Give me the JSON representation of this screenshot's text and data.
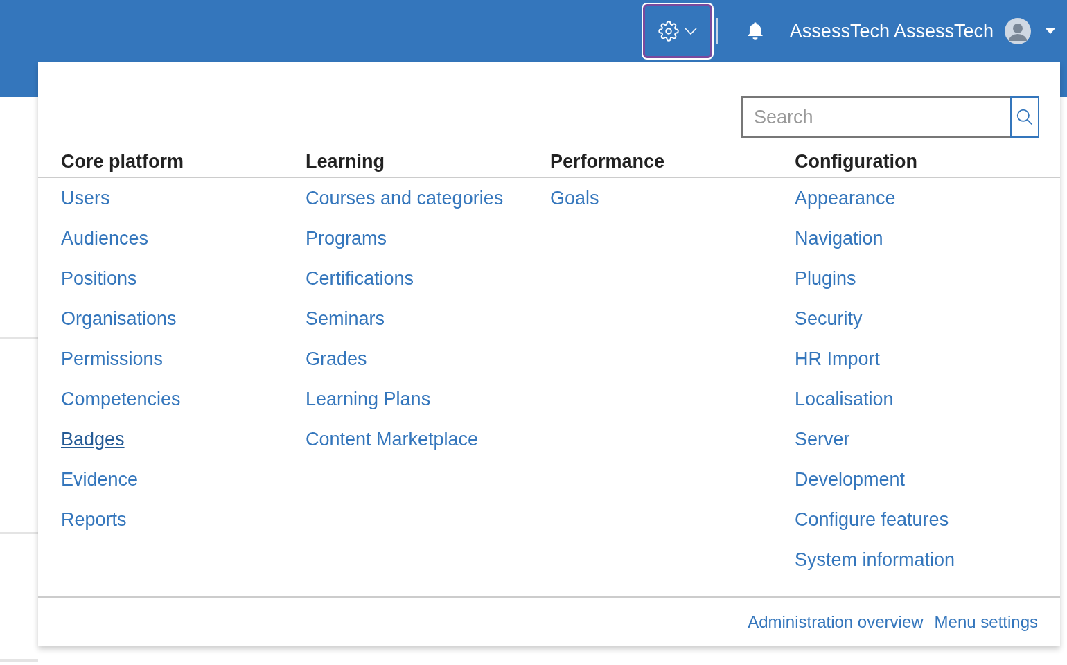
{
  "header": {
    "settings_button": {
      "focused": true
    },
    "user_name": "AssessTech AssessTech"
  },
  "admin_menu": {
    "search": {
      "placeholder": "Search"
    },
    "columns": [
      {
        "heading": "Core platform",
        "links": [
          {
            "label": "Users",
            "hovered": false
          },
          {
            "label": "Audiences",
            "hovered": false
          },
          {
            "label": "Positions",
            "hovered": false
          },
          {
            "label": "Organisations",
            "hovered": false
          },
          {
            "label": "Permissions",
            "hovered": false
          },
          {
            "label": "Competencies",
            "hovered": false
          },
          {
            "label": "Badges",
            "hovered": true
          },
          {
            "label": "Evidence",
            "hovered": false
          },
          {
            "label": "Reports",
            "hovered": false
          }
        ]
      },
      {
        "heading": "Learning",
        "links": [
          {
            "label": "Courses and categories",
            "hovered": false
          },
          {
            "label": "Programs",
            "hovered": false
          },
          {
            "label": "Certifications",
            "hovered": false
          },
          {
            "label": "Seminars",
            "hovered": false
          },
          {
            "label": "Grades",
            "hovered": false
          },
          {
            "label": "Learning Plans",
            "hovered": false
          },
          {
            "label": "Content Marketplace",
            "hovered": false
          }
        ]
      },
      {
        "heading": "Performance",
        "links": [
          {
            "label": "Goals",
            "hovered": false
          }
        ]
      },
      {
        "heading": "Configuration",
        "links": [
          {
            "label": "Appearance",
            "hovered": false
          },
          {
            "label": "Navigation",
            "hovered": false
          },
          {
            "label": "Plugins",
            "hovered": false
          },
          {
            "label": "Security",
            "hovered": false
          },
          {
            "label": "HR Import",
            "hovered": false
          },
          {
            "label": "Localisation",
            "hovered": false
          },
          {
            "label": "Server",
            "hovered": false
          },
          {
            "label": "Development",
            "hovered": false
          },
          {
            "label": "Configure features",
            "hovered": false
          },
          {
            "label": "System information",
            "hovered": false
          }
        ]
      }
    ],
    "footer_links": [
      "Administration overview",
      "Menu settings"
    ]
  }
}
